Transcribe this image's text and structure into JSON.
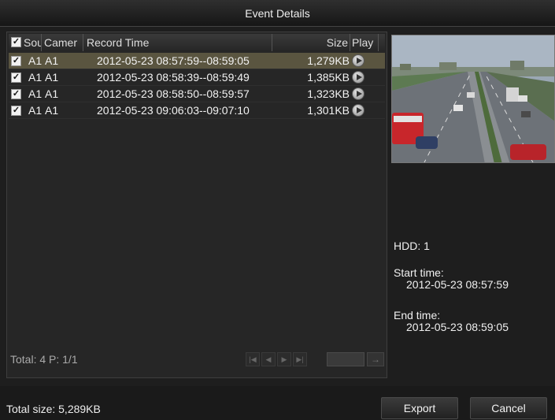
{
  "window": {
    "title": "Event Details"
  },
  "table": {
    "headers": {
      "source": "Sou",
      "camera": "Camer",
      "record_time": "Record Time",
      "size": "Size",
      "play": "Play"
    },
    "rows": [
      {
        "source": "A1",
        "camera": "A1",
        "record_time": "2012-05-23 08:57:59--08:59:05",
        "size": "1,279KB",
        "checked": true,
        "selected": true
      },
      {
        "source": "A1",
        "camera": "A1",
        "record_time": "2012-05-23 08:58:39--08:59:49",
        "size": "1,385KB",
        "checked": true,
        "selected": false
      },
      {
        "source": "A1",
        "camera": "A1",
        "record_time": "2012-05-23 08:58:50--08:59:57",
        "size": "1,323KB",
        "checked": true,
        "selected": false
      },
      {
        "source": "A1",
        "camera": "A1",
        "record_time": "2012-05-23 09:06:03--09:07:10",
        "size": "1,301KB",
        "checked": true,
        "selected": false
      }
    ]
  },
  "pagination": {
    "total_label": "Total: 4  P: 1/1"
  },
  "details": {
    "hdd": "HDD: 1",
    "start_label": "Start time:",
    "start_value": "2012-05-23 08:57:59",
    "end_label": "End time:",
    "end_value": "2012-05-23 08:59:05"
  },
  "footer": {
    "total_size": "Total size: 5,289KB",
    "export_label": "Export",
    "cancel_label": "Cancel"
  },
  "icons": {
    "check": "checkbox-checked-icon",
    "play": "play-icon",
    "first": "first-page-icon",
    "prev": "prev-page-icon",
    "next": "next-page-icon",
    "last": "last-page-icon",
    "go": "go-arrow-icon"
  },
  "colors": {
    "selected_row": "#5a5540",
    "background": "#1e1e1e"
  }
}
